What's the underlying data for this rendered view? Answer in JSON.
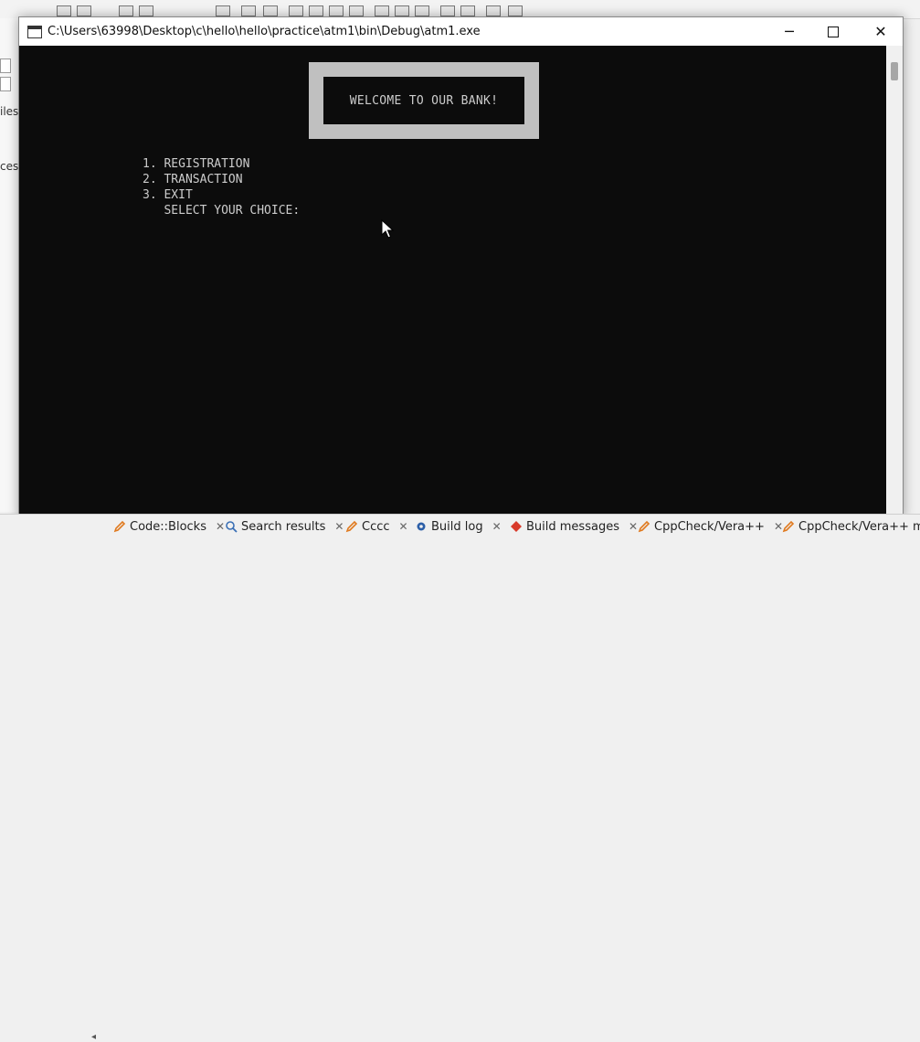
{
  "console": {
    "title": "C:\\Users\\63998\\Desktop\\c\\hello\\hello\\practice\\atm1\\bin\\Debug\\atm1.exe",
    "banner": "WELCOME TO OUR BANK!",
    "menu": [
      "1. REGISTRATION",
      "2. TRANSACTION",
      "3. EXIT",
      "   SELECT YOUR CHOICE:"
    ]
  },
  "window_buttons": {
    "minimize": "─",
    "close": "✕"
  },
  "ide": {
    "left_labels": [
      "iles",
      "ces"
    ],
    "bottom_tabs": [
      {
        "label": "Code::Blocks",
        "icon": "pencil-icon",
        "color": "#e07a1f"
      },
      {
        "label": "Search results",
        "icon": "search-icon",
        "color": "#3a6fb5"
      },
      {
        "label": "Cccc",
        "icon": "pencil-icon",
        "color": "#e07a1f"
      },
      {
        "label": "Build log",
        "icon": "gear-icon",
        "color": "#2c5fa8"
      },
      {
        "label": "Build messages",
        "icon": "diamond-icon",
        "color": "#d83a2a"
      },
      {
        "label": "CppCheck/Vera++",
        "icon": "pencil-icon",
        "color": "#e07a1f"
      },
      {
        "label": "CppCheck/Vera++ mes",
        "icon": "pencil-icon",
        "color": "#e07a1f"
      }
    ]
  }
}
